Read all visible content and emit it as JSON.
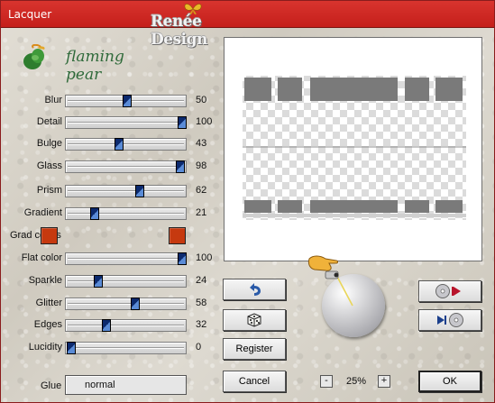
{
  "window": {
    "title": "Lacquer"
  },
  "watermark": {
    "text": "Renée Design"
  },
  "logo": {
    "text": "flaming pear"
  },
  "sliders": [
    {
      "label": "Blur",
      "value": "50",
      "level": 50
    },
    {
      "label": "Detail",
      "value": "100",
      "level": 100
    },
    {
      "label": "Bulge",
      "value": "43",
      "level": 43
    },
    {
      "label": "Glass",
      "value": "98",
      "level": 98
    },
    {
      "label": "Prism",
      "value": "62",
      "level": 62
    },
    {
      "label": "Gradient",
      "value": "21",
      "level": 21
    }
  ],
  "grad_colors": {
    "label": "Grad colors",
    "color1": "#c6390f",
    "color2": "#c6390f"
  },
  "sliders2": [
    {
      "label": "Flat color",
      "value": "100",
      "level": 100
    },
    {
      "label": "Sparkle",
      "value": "24",
      "level": 24
    },
    {
      "label": "Glitter",
      "value": "58",
      "level": 58
    },
    {
      "label": "Edges",
      "value": "32",
      "level": 32
    },
    {
      "label": "Lucidity",
      "value": "0",
      "level": 0
    }
  ],
  "glue": {
    "label": "Glue",
    "value": "normal"
  },
  "buttons": {
    "register": "Register",
    "cancel": "Cancel",
    "ok": "OK"
  },
  "zoom": {
    "minus": "-",
    "value": "25%",
    "plus": "+"
  },
  "icons": {
    "undo": "undo-arrow-icon",
    "random": "dice-icon",
    "save": "disc-save-icon",
    "load": "disc-load-icon",
    "light": "light-direction-dial",
    "pointer": "pointing-hand-icon"
  },
  "colors": {
    "titlebar": "#c8221e",
    "thumb": "#0c2a6e",
    "swatch": "#c6390f",
    "logo_text": "#2f6a3a"
  }
}
